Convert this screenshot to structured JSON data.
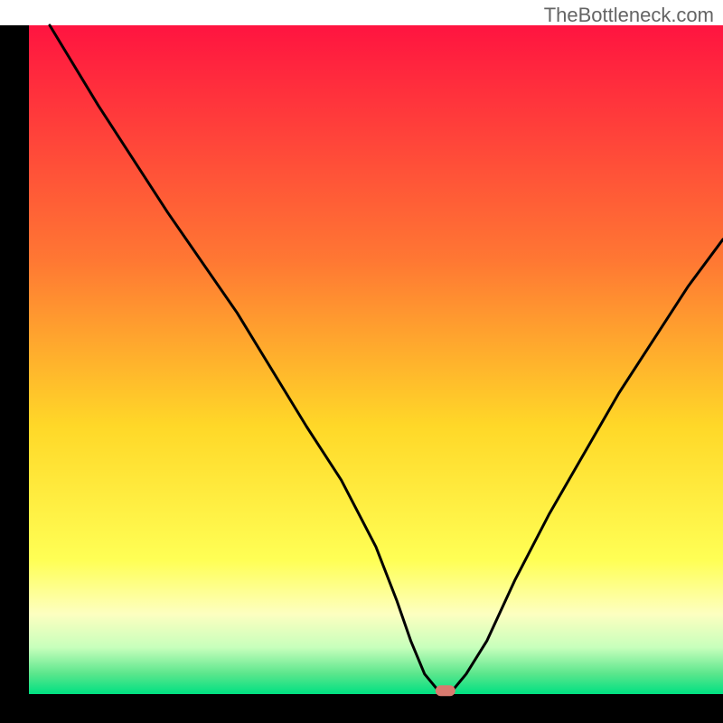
{
  "watermark": "TheBottleneck.com",
  "chart_data": {
    "type": "line",
    "title": "",
    "xlabel": "",
    "ylabel": "",
    "xlim": [
      0,
      100
    ],
    "ylim": [
      0,
      100
    ],
    "grid": false,
    "legend": false,
    "series": [
      {
        "name": "bottleneck-curve",
        "x": [
          3,
          10,
          20,
          30,
          40,
          45,
          50,
          53,
          55,
          57,
          59,
          61,
          63,
          66,
          70,
          75,
          80,
          85,
          90,
          95,
          100
        ],
        "values": [
          100,
          88,
          72,
          57,
          40,
          32,
          22,
          14,
          8,
          3,
          0.5,
          0.5,
          3,
          8,
          17,
          27,
          36,
          45,
          53,
          61,
          68
        ]
      }
    ],
    "marker": {
      "x": 60,
      "y": 0.5,
      "color": "#d97a6f"
    },
    "background_gradient": {
      "stops": [
        {
          "offset": 0.0,
          "color": "#ff1440"
        },
        {
          "offset": 0.35,
          "color": "#ff7733"
        },
        {
          "offset": 0.6,
          "color": "#ffd828"
        },
        {
          "offset": 0.8,
          "color": "#ffff55"
        },
        {
          "offset": 0.88,
          "color": "#fdffc0"
        },
        {
          "offset": 0.93,
          "color": "#c8ffbc"
        },
        {
          "offset": 0.97,
          "color": "#5ae68c"
        },
        {
          "offset": 1.0,
          "color": "#00e082"
        }
      ]
    },
    "axis_thickness": 32
  }
}
